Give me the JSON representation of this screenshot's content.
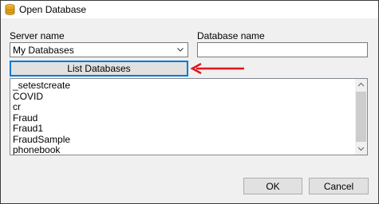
{
  "window": {
    "title": "Open Database"
  },
  "server": {
    "label": "Server name",
    "selected": "My Databases"
  },
  "database": {
    "label": "Database name",
    "value": ""
  },
  "list_button": {
    "label": "List Databases"
  },
  "databases": [
    "_setestcreate",
    "COVID",
    "cr",
    "Fraud",
    "Fraud1",
    "FraudSample",
    "phonebook"
  ],
  "footer": {
    "ok_label": "OK",
    "cancel_label": "Cancel"
  },
  "colors": {
    "accent": "#0078d7",
    "annotation_arrow": "#e0151f",
    "icon": "#d4a017"
  }
}
